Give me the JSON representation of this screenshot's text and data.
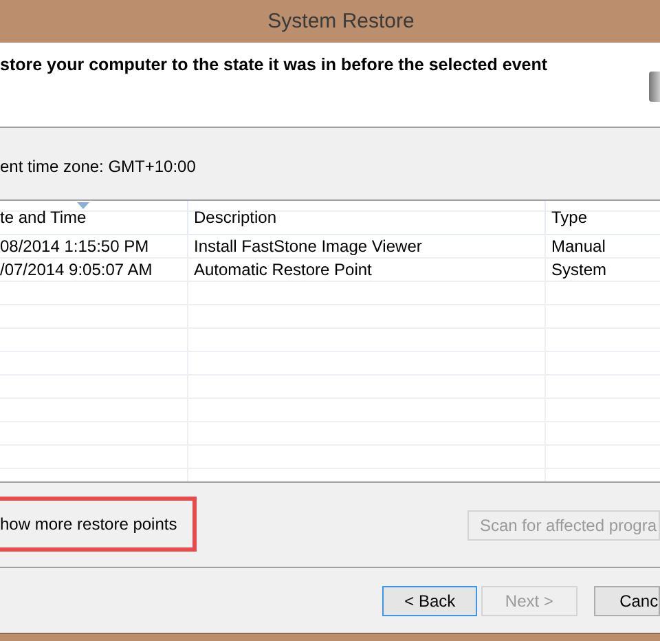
{
  "window": {
    "title": "System Restore"
  },
  "header": {
    "instruction": "store your computer to the state it was in before the selected event"
  },
  "time_zone": "ent time zone: GMT+10:00",
  "table": {
    "columns": [
      {
        "label": "te and Time",
        "sorted": true
      },
      {
        "label": "Description",
        "sorted": false
      },
      {
        "label": "Type",
        "sorted": false
      }
    ],
    "rows": [
      {
        "cells": [
          "08/2014 1:15:50 PM",
          "Install FastStone Image Viewer",
          "Manual"
        ]
      },
      {
        "cells": [
          "/07/2014 9:05:07 AM",
          "Automatic Restore Point",
          "System"
        ]
      }
    ]
  },
  "show_more": {
    "label": "how more restore points",
    "highlighted": true
  },
  "scan_button": {
    "label": "Scan for affected progra",
    "disabled": true
  },
  "buttons": [
    {
      "label": "< Back",
      "disabled": false,
      "focused": true
    },
    {
      "label": "Next >",
      "disabled": true,
      "focused": false
    },
    {
      "label": "Canc",
      "disabled": false,
      "focused": false
    }
  ]
}
